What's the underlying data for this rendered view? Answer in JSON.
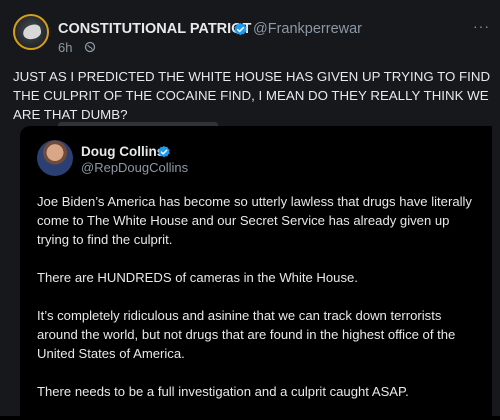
{
  "tweet": {
    "author_name": "CONSTITUTIONAL PATRIOT",
    "handle": "@Frankperrewar",
    "time": "6h",
    "text": "JUST AS I PREDICTED THE WHITE HOUSE HAS GIVEN UP TRYING TO FIND THE CULPRIT OF THE COCAINE FIND, I MEAN DO THEY REALLY THINK WE ARE THAT DUMB?",
    "more_label": "···"
  },
  "quoted": {
    "author_name": "Doug Collins",
    "handle": "@RepDougCollins",
    "paragraphs": [
      "Joe Biden’s America has become so utterly lawless that drugs have literally come to The White House and our Secret Service has already given up trying to find the culprit.",
      "There are HUNDREDS of cameras in the White House.",
      "It’s completely ridiculous and asinine that we can track down terrorists around the world, but not drugs that are found in the highest office of the United States of America.",
      "There needs to be a full investigation and a culprit caught ASAP."
    ]
  },
  "colors": {
    "verified": "#1d9bf0",
    "text": "#e7e9ea",
    "secondary": "#8b98a5"
  }
}
